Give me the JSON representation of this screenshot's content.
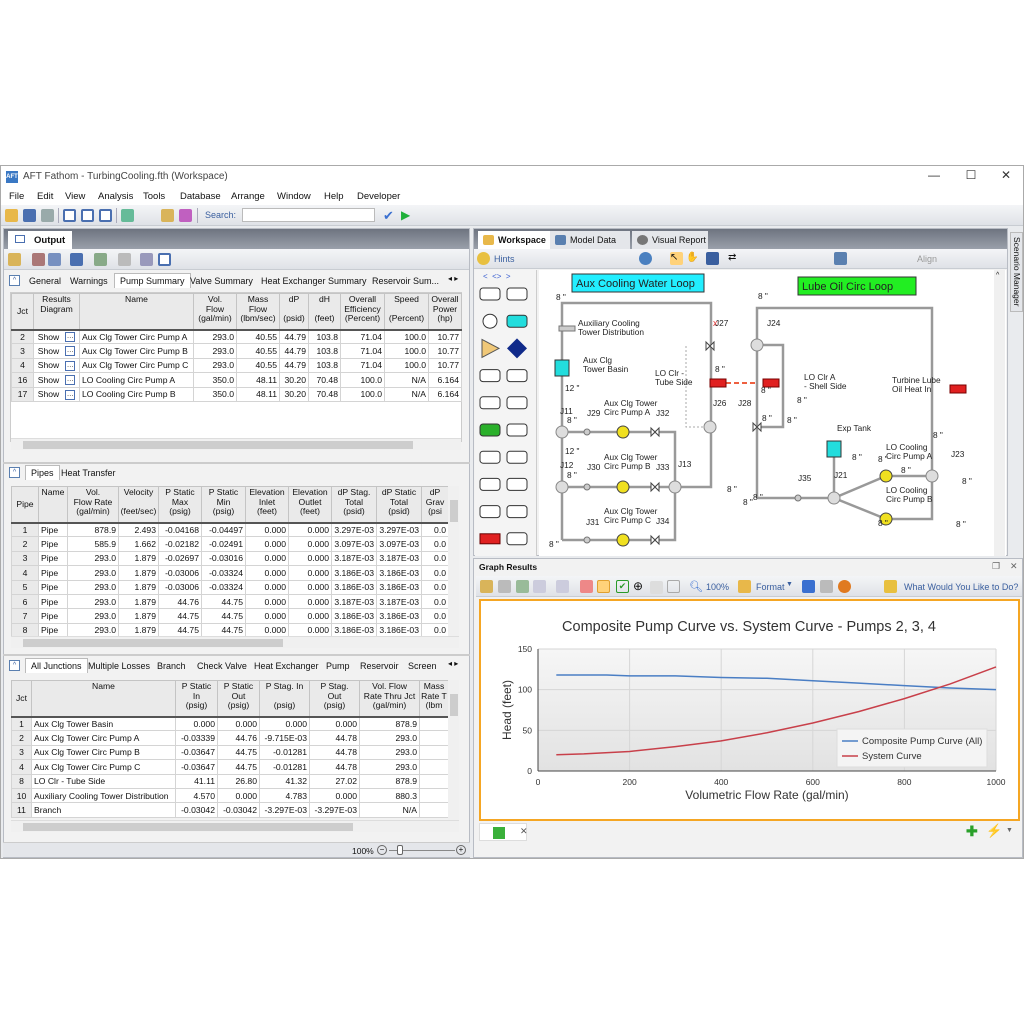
{
  "window": {
    "title": "AFT Fathom - TurbingCooling.fth (Workspace)",
    "minimize": "—",
    "maximize": "☐",
    "close": "✕"
  },
  "menu": [
    "File",
    "Edit",
    "View",
    "Analysis",
    "Tools",
    "Database",
    "Arrange",
    "Window",
    "Help",
    "Developer"
  ],
  "toolbar": {
    "search_label": "Search:",
    "search_value": ""
  },
  "output": {
    "title": "Output",
    "tabs": [
      "General",
      "Warnings",
      "Pump Summary",
      "Valve Summary",
      "Heat Exchanger Summary",
      "Reservoir Sum..."
    ],
    "active_tab": "Pump Summary",
    "pump_table": {
      "headers": [
        "Jct",
        "Results\nDiagram",
        "Name",
        "Vol.\nFlow\n(gal/min)",
        "Mass\nFlow\n(lbm/sec)",
        "dP\n\n(psid)",
        "dH\n\n(feet)",
        "Overall\nEfficiency\n(Percent)",
        "Speed\n\n(Percent)",
        "Overall\nPower\n(hp)"
      ],
      "rows": [
        [
          "2",
          "Show",
          "Aux Clg Tower Circ Pump A",
          "293.0",
          "40.55",
          "44.79",
          "103.8",
          "71.04",
          "100.0",
          "10.77"
        ],
        [
          "3",
          "Show",
          "Aux Clg Tower Circ Pump B",
          "293.0",
          "40.55",
          "44.79",
          "103.8",
          "71.04",
          "100.0",
          "10.77"
        ],
        [
          "4",
          "Show",
          "Aux Clg Tower Circ Pump C",
          "293.0",
          "40.55",
          "44.79",
          "103.8",
          "71.04",
          "100.0",
          "10.77"
        ],
        [
          "16",
          "Show",
          "LO Cooling Circ Pump A",
          "350.0",
          "48.11",
          "30.20",
          "70.48",
          "100.0",
          "N/A",
          "6.164"
        ],
        [
          "17",
          "Show",
          "LO Cooling Circ Pump B",
          "350.0",
          "48.11",
          "30.20",
          "70.48",
          "100.0",
          "N/A",
          "6.164"
        ]
      ]
    },
    "pipes_tabs": [
      "Pipes",
      "Heat Transfer"
    ],
    "pipes_table": {
      "headers": [
        "Pipe",
        "Name",
        "Vol.\nFlow Rate\n(gal/min)",
        "Velocity\n\n(feet/sec)",
        "P Static\nMax\n(psig)",
        "P Static\nMin\n(psig)",
        "Elevation\nInlet\n(feet)",
        "Elevation\nOutlet\n(feet)",
        "dP Stag.\nTotal\n(psid)",
        "dP Static\nTotal\n(psid)",
        "dP\nGrav\n(psi"
      ],
      "rows": [
        [
          "1",
          "Pipe",
          "878.9",
          "2.493",
          "-0.04168",
          "-0.04497",
          "0.000",
          "0.000",
          "3.297E-03",
          "3.297E-03",
          "0.0"
        ],
        [
          "2",
          "Pipe",
          "585.9",
          "1.662",
          "-0.02182",
          "-0.02491",
          "0.000",
          "0.000",
          "3.097E-03",
          "3.097E-03",
          "0.0"
        ],
        [
          "3",
          "Pipe",
          "293.0",
          "1.879",
          "-0.02697",
          "-0.03016",
          "0.000",
          "0.000",
          "3.187E-03",
          "3.187E-03",
          "0.0"
        ],
        [
          "4",
          "Pipe",
          "293.0",
          "1.879",
          "-0.03006",
          "-0.03324",
          "0.000",
          "0.000",
          "3.186E-03",
          "3.186E-03",
          "0.0"
        ],
        [
          "5",
          "Pipe",
          "293.0",
          "1.879",
          "-0.03006",
          "-0.03324",
          "0.000",
          "0.000",
          "3.186E-03",
          "3.186E-03",
          "0.0"
        ],
        [
          "6",
          "Pipe",
          "293.0",
          "1.879",
          "44.76",
          "44.75",
          "0.000",
          "0.000",
          "3.187E-03",
          "3.187E-03",
          "0.0"
        ],
        [
          "7",
          "Pipe",
          "293.0",
          "1.879",
          "44.75",
          "44.75",
          "0.000",
          "0.000",
          "3.186E-03",
          "3.186E-03",
          "0.0"
        ],
        [
          "8",
          "Pipe",
          "293.0",
          "1.879",
          "44.75",
          "44.75",
          "0.000",
          "0.000",
          "3.186E-03",
          "3.186E-03",
          "0.0"
        ]
      ]
    },
    "junction_tabs": [
      "All Junctions",
      "Multiple Losses",
      "Branch",
      "Check Valve",
      "Heat Exchanger",
      "Pump",
      "Reservoir",
      "Screen"
    ],
    "junction_table": {
      "headers": [
        "Jct",
        "Name",
        "P Static\nIn\n(psig)",
        "P Static\nOut\n(psig)",
        "P Stag. In\n\n(psig)",
        "P Stag.\nOut\n(psig)",
        "Vol. Flow\nRate Thru Jct\n(gal/min)",
        "Mass\nRate T\n(lbm"
      ],
      "rows": [
        [
          "1",
          "Aux Clg Tower Basin",
          "0.000",
          "0.000",
          "0.000",
          "0.000",
          "878.9",
          ""
        ],
        [
          "2",
          "Aux Clg Tower Circ Pump A",
          "-0.03339",
          "44.76",
          "-9.715E-03",
          "44.78",
          "293.0",
          ""
        ],
        [
          "3",
          "Aux Clg Tower Circ Pump B",
          "-0.03647",
          "44.75",
          "-0.01281",
          "44.78",
          "293.0",
          ""
        ],
        [
          "4",
          "Aux Clg Tower Circ Pump C",
          "-0.03647",
          "44.75",
          "-0.01281",
          "44.78",
          "293.0",
          ""
        ],
        [
          "8",
          "LO Clr - Tube Side",
          "41.11",
          "26.80",
          "41.32",
          "27.02",
          "878.9",
          ""
        ],
        [
          "10",
          "Auxiliary Cooling Tower Distribution",
          "4.570",
          "0.000",
          "4.783",
          "0.000",
          "880.3",
          ""
        ],
        [
          "11",
          "Branch",
          "-0.03042",
          "-0.03042",
          "-3.297E-03",
          "-3.297E-03",
          "N/A",
          ""
        ]
      ]
    },
    "zoom": "100%"
  },
  "workspace": {
    "tabs": [
      "Workspace",
      "Model Data",
      "Visual Report"
    ],
    "hints": "Hints",
    "align": "Align",
    "scenario_manager": "Scenario Manager",
    "loop_labels": [
      {
        "text": "Aux Cooling Water Loop",
        "color": "#22eeff"
      },
      {
        "text": "Lube Oil Circ Loop",
        "color": "#22ee22"
      }
    ],
    "labels": [
      "Auxiliary Cooling\nTower Distribution",
      "Aux Clg\nTower Basin",
      "Aux Clg Tower\nCirc Pump A",
      "Aux Clg Tower\nCirc Pump B",
      "Aux Clg Tower\nCirc Pump C",
      "LO Clr -\nTube Side",
      "LO Clr A\n- Shell Side",
      "Turbine Lube\nOil Heat In",
      "Exp Tank",
      "LO Cooling\nCirc Pump A",
      "LO Cooling\nCirc Pump B",
      "J11",
      "J12",
      "J13",
      "J29",
      "J30",
      "J31",
      "J32",
      "J33",
      "J34",
      "J27",
      "J26",
      "J24",
      "J28",
      "J35",
      "J21",
      "J23",
      "8 \"",
      "12 \"",
      "12 \"",
      "8 \"",
      "8 \"",
      "8 \"",
      "8 \"",
      "8 \"",
      "8 \"",
      "8 \"",
      "8 \"",
      "8 \"",
      "8 \"",
      "8 \"",
      "8 \"",
      "8 \"",
      "8 \"",
      "8 \"",
      "8 \"",
      "8 \"",
      "8 \"",
      "8 \""
    ]
  },
  "graph": {
    "panel_title": "Graph Results",
    "zoom": "100%",
    "format": "Format",
    "help": "What Would You Like to Do?",
    "accent": "#f5a623"
  },
  "chart_data": {
    "type": "line",
    "title": "Composite Pump Curve vs. System Curve - Pumps 2, 3, 4",
    "xlabel": "Volumetric Flow Rate (gal/min)",
    "ylabel": "Head (feet)",
    "xlim": [
      0,
      1000
    ],
    "ylim": [
      0,
      150
    ],
    "xticks": [
      "0",
      "200",
      "400",
      "600",
      "800",
      "1000"
    ],
    "yticks": [
      "0",
      "50",
      "100",
      "150"
    ],
    "grid": true,
    "legend": "bottom-right",
    "series": [
      {
        "name": "Composite Pump Curve (All)",
        "color": "#4a7ec4",
        "x": [
          40,
          150,
          200,
          300,
          400,
          500,
          600,
          700,
          800,
          900,
          1000
        ],
        "y": [
          118,
          118,
          117,
          117,
          115,
          114,
          111,
          108,
          105,
          102,
          100
        ]
      },
      {
        "name": "System Curve",
        "color": "#c8404a",
        "x": [
          40,
          100,
          200,
          300,
          400,
          500,
          600,
          700,
          800,
          900,
          1000
        ],
        "y": [
          20,
          21,
          24,
          30,
          37,
          47,
          59,
          73,
          89,
          107,
          128
        ]
      }
    ]
  }
}
